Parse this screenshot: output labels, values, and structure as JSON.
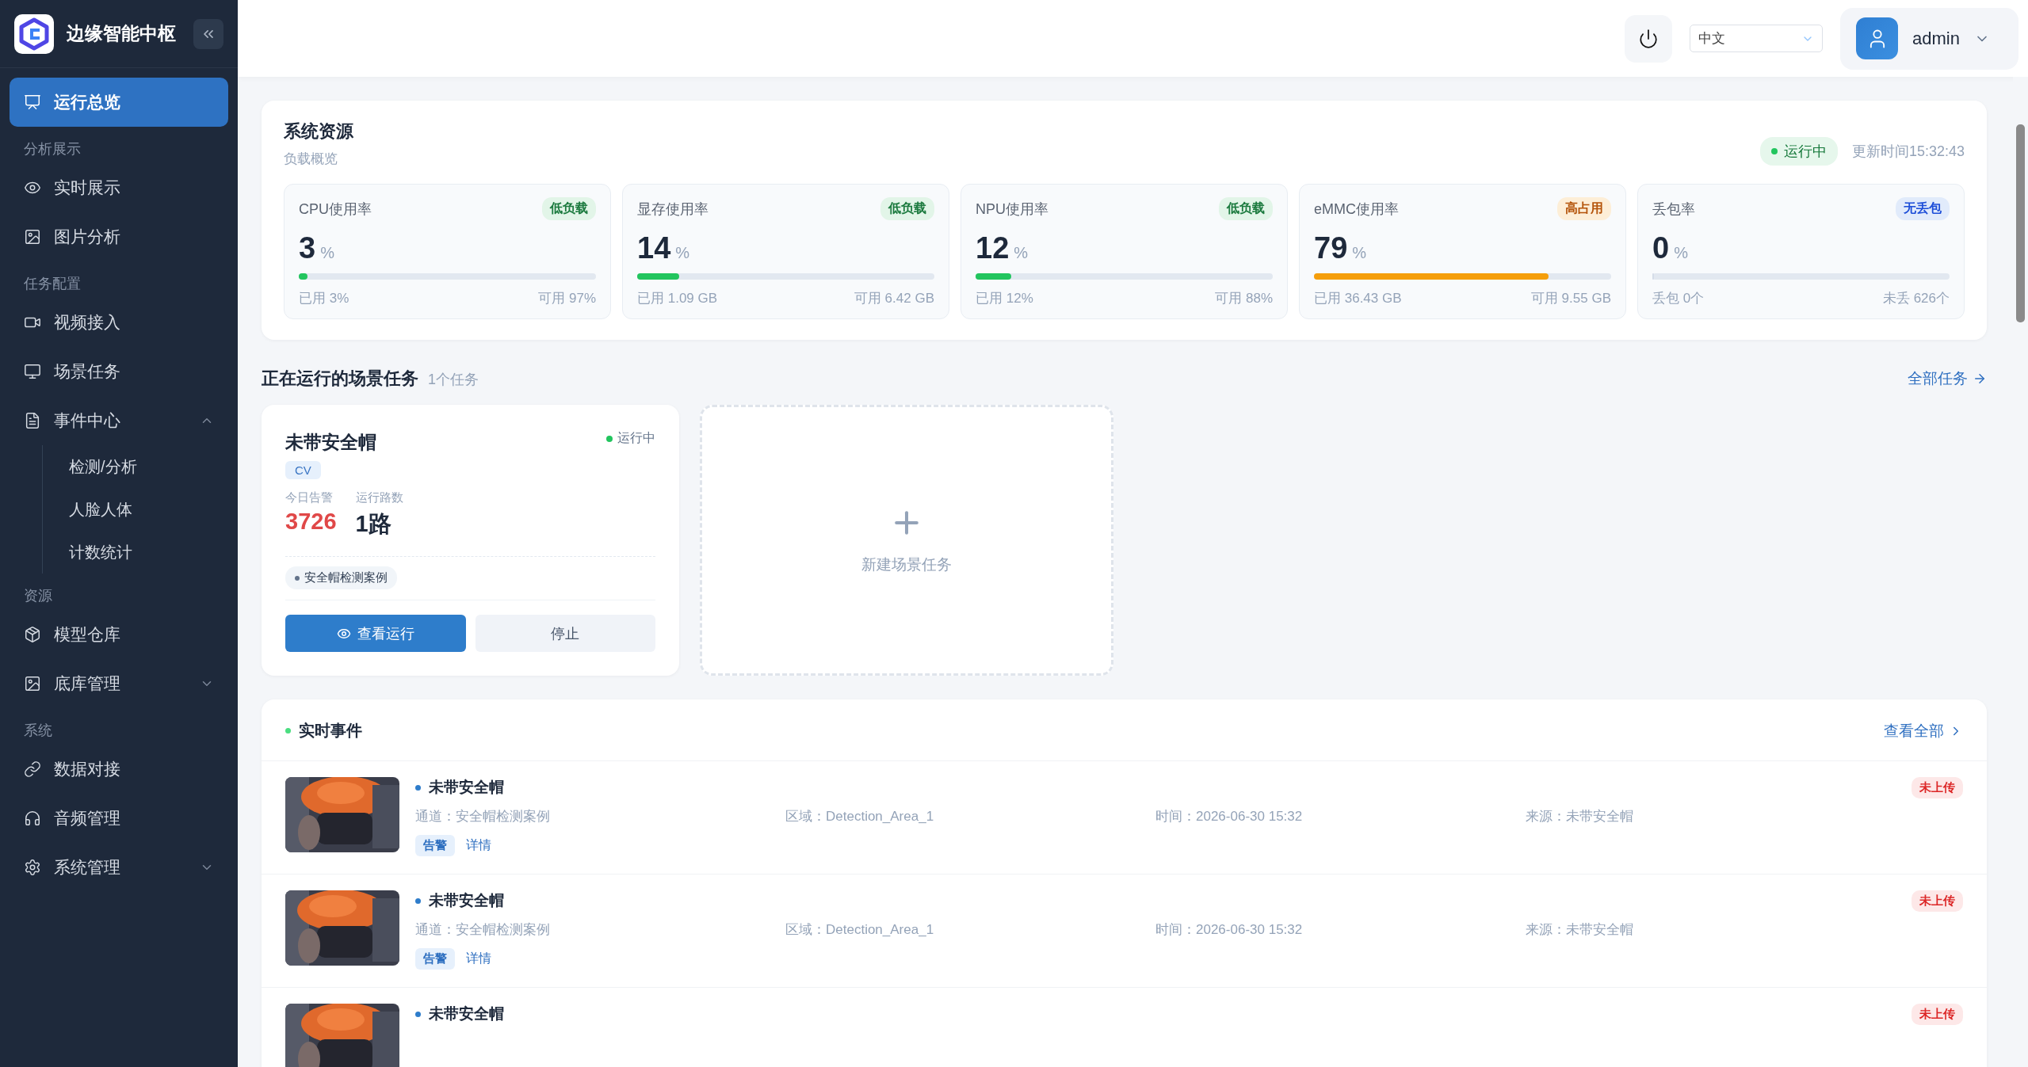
{
  "sidebar": {
    "title": "边缘智能中枢",
    "groups": [
      {
        "items": [
          {
            "label": "运行总览",
            "selected": true
          }
        ]
      },
      {
        "heading": "分析展示",
        "items": [
          {
            "label": "实时展示",
            "selected": false
          },
          {
            "label": "图片分析",
            "selected": false
          }
        ]
      },
      {
        "heading": "任务配置",
        "items": [
          {
            "label": "视频接入",
            "selected": false
          },
          {
            "label": "场景任务",
            "selected": false
          },
          {
            "label": "事件中心",
            "selected": false,
            "expanded": true,
            "children": [
              {
                "label": "检测/分析",
                "selected": false
              },
              {
                "label": "人脸人体",
                "selected": false
              },
              {
                "label": "计数统计",
                "selected": false
              }
            ]
          }
        ]
      },
      {
        "heading": "资源",
        "items": [
          {
            "label": "模型仓库",
            "selected": false
          },
          {
            "label": "底库管理",
            "selected": false,
            "expanded": false
          }
        ]
      },
      {
        "heading": "系统",
        "items": [
          {
            "label": "数据对接",
            "selected": false
          },
          {
            "label": "音频管理",
            "selected": false
          },
          {
            "label": "系统管理",
            "selected": false,
            "expanded": false
          }
        ]
      }
    ]
  },
  "header": {
    "language": "中文",
    "user": "admin"
  },
  "resources": {
    "title": "系统资源",
    "subtitle": "负载概览",
    "status": "运行中",
    "updated": "更新时间15:32:43",
    "metrics": [
      {
        "label": "CPU使用率",
        "value": "3",
        "unit": "%",
        "badge": {
          "text": "低负载",
          "kind": "ok"
        },
        "level": 0.03,
        "color": "#22c55e",
        "used": "已用 3%",
        "available": "可用 97%"
      },
      {
        "label": "显存使用率",
        "value": "14",
        "unit": "%",
        "badge": {
          "text": "低负载",
          "kind": "ok"
        },
        "level": 0.14,
        "color": "#22c55e",
        "used": "已用 1.09 GB",
        "available": "可用 6.42 GB"
      },
      {
        "label": "NPU使用率",
        "value": "12",
        "unit": "%",
        "badge": {
          "text": "低负载",
          "kind": "ok"
        },
        "level": 0.12,
        "color": "#22c55e",
        "used": "已用 12%",
        "available": "可用 88%"
      },
      {
        "label": "eMMC使用率",
        "value": "79",
        "unit": "%",
        "badge": {
          "text": "高占用",
          "kind": "warn"
        },
        "level": 0.79,
        "color": "#f59e0b",
        "used": "已用 36.43 GB",
        "available": "可用 9.55 GB"
      },
      {
        "label": "丢包率",
        "value": "0",
        "unit": "%",
        "badge": {
          "text": "无丢包",
          "kind": "info"
        },
        "level": 0,
        "used": "丢包 0个",
        "available": "未丢 626个"
      }
    ]
  },
  "tasks": {
    "title": "正在运行的场景任务",
    "count": "1个任务",
    "link": "全部任务",
    "items": [
      {
        "name": "未带安全帽",
        "status": "运行中",
        "tag": "CV",
        "stats": [
          {
            "label": "今日告警",
            "value": "3726",
            "kind": "alert"
          },
          {
            "label": "运行路数",
            "value": "1路",
            "kind": "normal"
          }
        ],
        "channel": "安全帽检测案例",
        "primary": "查看运行",
        "secondary": "停止"
      }
    ],
    "new_task": "新建场景任务"
  },
  "events": {
    "title": "实时事件",
    "link": "查看全部",
    "rows": [
      {
        "title": "未带安全帽",
        "status": "未上传",
        "fields": [
          "通道：安全帽检测案例",
          "区域：Detection_Area_1",
          "时间：2026-06-30 15:32",
          "来源：未带安全帽"
        ],
        "tag": "告警",
        "action": "详情"
      },
      {
        "title": "未带安全帽",
        "status": "未上传",
        "fields": [
          "通道：安全帽检测案例",
          "区域：Detection_Area_1",
          "时间：2026-06-30 15:32",
          "来源：未带安全帽"
        ],
        "tag": "告警",
        "action": "详情"
      },
      {
        "title": "未带安全帽",
        "status": "未上传"
      }
    ]
  }
}
